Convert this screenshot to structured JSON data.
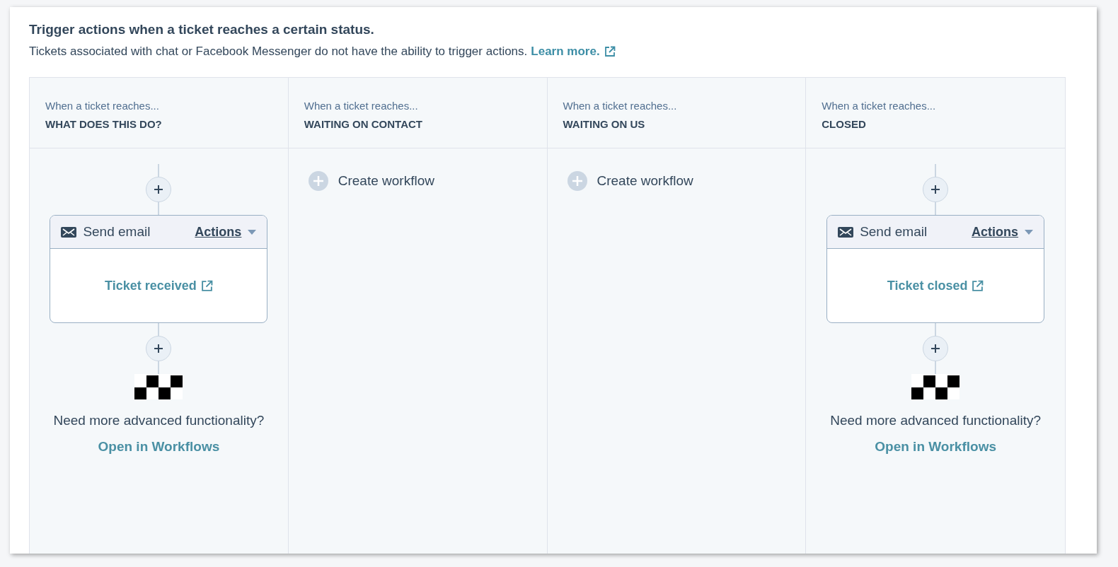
{
  "heading": "Trigger actions when a ticket reaches a certain status.",
  "description": "Tickets associated with chat or Facebook Messenger do not have the ability to trigger actions.",
  "learn_more_link": "Learn more.",
  "columns": [
    {
      "prefix": "When a ticket reaches...",
      "status": "WHAT DOES THIS DO?",
      "kind": "workflow",
      "action": "Send email",
      "actions_menu": "Actions",
      "email_link": "Ticket received",
      "prompt": "Need more advanced functionality?",
      "open_link": "Open in Workflows"
    },
    {
      "prefix": "When a ticket reaches...",
      "status": "WAITING ON CONTACT",
      "kind": "empty",
      "create_label": "Create workflow"
    },
    {
      "prefix": "When a ticket reaches...",
      "status": "WAITING ON US",
      "kind": "empty",
      "create_label": "Create workflow"
    },
    {
      "prefix": "When a ticket reaches...",
      "status": "CLOSED",
      "kind": "workflow",
      "action": "Send email",
      "actions_menu": "Actions",
      "email_link": "Ticket closed",
      "prompt": "Need more advanced functionality?",
      "open_link": "Open in Workflows"
    }
  ]
}
